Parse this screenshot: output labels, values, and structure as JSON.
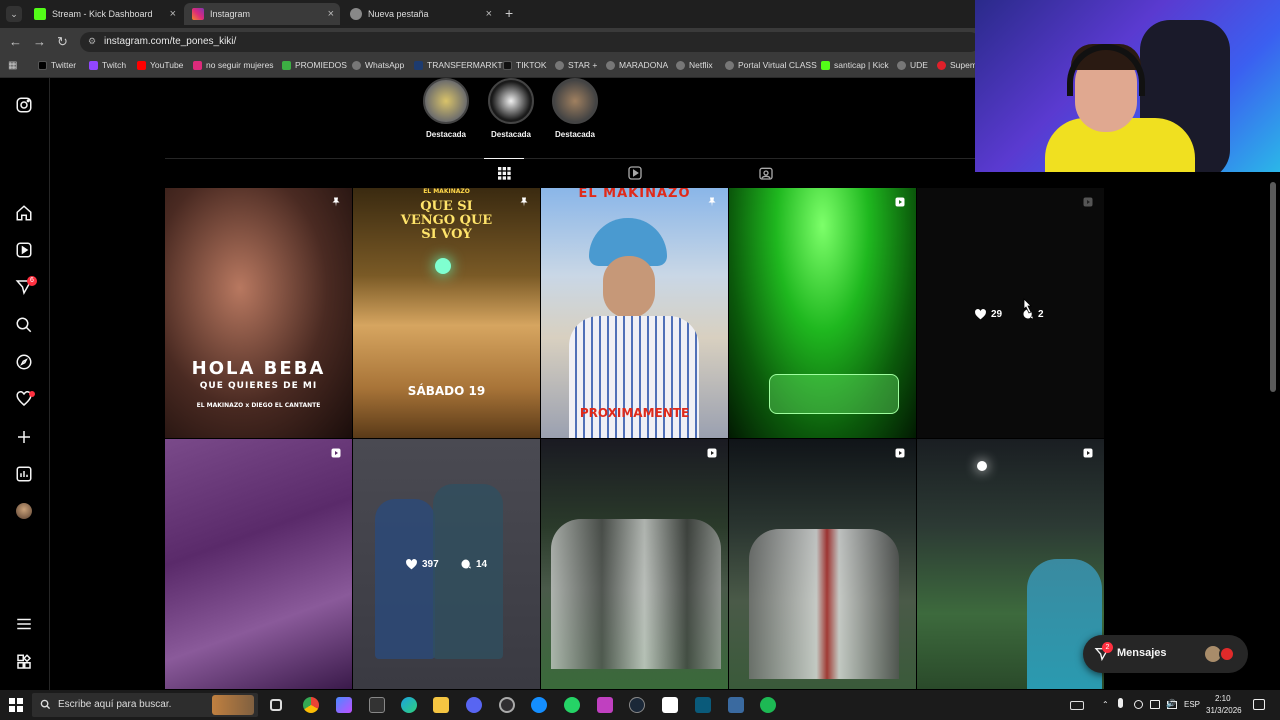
{
  "browser": {
    "tabs": [
      {
        "label": "Stream - Kick Dashboard",
        "color": "#53fc18"
      },
      {
        "label": "Instagram",
        "color": "#e1306c"
      },
      {
        "label": "Nueva pestaña",
        "color": "#cccccc"
      }
    ],
    "url": "instagram.com/te_pones_kiki/",
    "bookmarks": [
      {
        "label": "Twitter"
      },
      {
        "label": "Twitch"
      },
      {
        "label": "YouTube"
      },
      {
        "label": "no seguir mujeres"
      },
      {
        "label": "PROMIEDOS"
      },
      {
        "label": "WhatsApp"
      },
      {
        "label": "TRANSFERMARKT"
      },
      {
        "label": "TIKTOK"
      },
      {
        "label": "STAR +"
      },
      {
        "label": "MARADONA"
      },
      {
        "label": "Netflix"
      },
      {
        "label": "Portal Virtual CLASS"
      },
      {
        "label": "santicap | Kick"
      },
      {
        "label": "UDE"
      },
      {
        "label": "Supem"
      }
    ]
  },
  "instagram": {
    "notifications_badge": "6",
    "highlights": [
      {
        "label": "Destacada"
      },
      {
        "label": "Destacada"
      },
      {
        "label": "Destacada"
      }
    ],
    "posts": {
      "p1": {
        "title": "HOLA BEBA",
        "subtitle": "QUE QUIERES DE MI",
        "credits": "EL MAKINAZO x DIEGO EL CANTANTE"
      },
      "p2": {
        "topline": "EL MAKINAZO",
        "title": "QUE SI VENGO QUE SI VOY",
        "date": "SÁBADO 19"
      },
      "p3": {
        "title": "EL MAKINAZO",
        "bottom": "PROXIMAMENTE"
      },
      "p5": {
        "likes": "29",
        "comments": "2"
      },
      "p7": {
        "likes": "397",
        "comments": "14"
      }
    },
    "messages_label": "Mensajes",
    "messages_badge": "2"
  },
  "taskbar": {
    "search_placeholder": "Escribe aquí para buscar.",
    "lang": "ESP",
    "time": "2:10",
    "date": "31/3/2026"
  },
  "colors": {
    "ig_bg": "#000000",
    "accent_red": "#ff3040",
    "green_post": "#1fb81f"
  }
}
